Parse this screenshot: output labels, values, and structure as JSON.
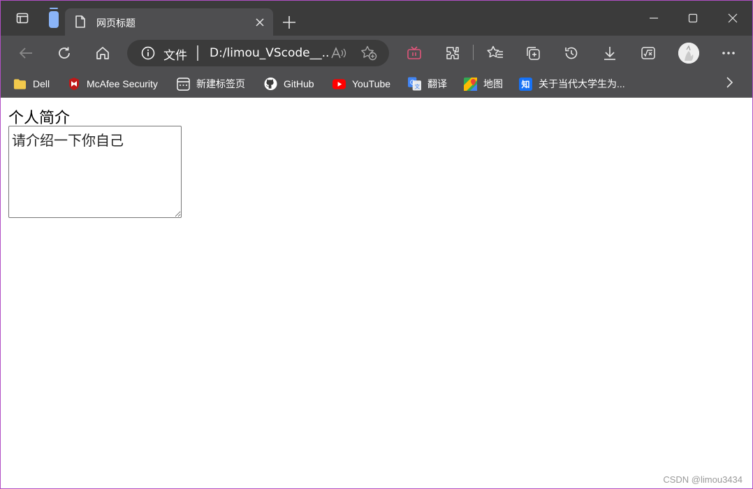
{
  "window": {
    "tab_title": "网页标题"
  },
  "address_bar": {
    "site_info_label": "文件",
    "url": "D:/limou_VScode__..."
  },
  "bookmarks": {
    "items": [
      {
        "label": "Dell",
        "icon": "folder-icon",
        "color": "#f2c94c"
      },
      {
        "label": "McAfee Security",
        "icon": "mcafee-icon",
        "color": "#c01818"
      },
      {
        "label": "新建标签页",
        "icon": "newtab-icon",
        "color": "#ffffff"
      },
      {
        "label": "GitHub",
        "icon": "github-icon",
        "color": "#ffffff"
      },
      {
        "label": "YouTube",
        "icon": "youtube-icon",
        "color": "#ff0000"
      },
      {
        "label": "翻译",
        "icon": "translate-icon",
        "color": "#4285f4"
      },
      {
        "label": "地图",
        "icon": "map-icon",
        "color": "#34a853"
      },
      {
        "label": "关于当代大学生为...",
        "icon": "zhihu-icon",
        "color": "#1772f6"
      }
    ]
  },
  "page": {
    "heading": "个人简介",
    "textarea_placeholder": "请介绍一下你自己"
  },
  "watermark": "CSDN @limou3434",
  "colors": {
    "titlebar": "#3b3b3b",
    "toolbar": "#4e4e50",
    "frame_border": "#b14fc5"
  }
}
